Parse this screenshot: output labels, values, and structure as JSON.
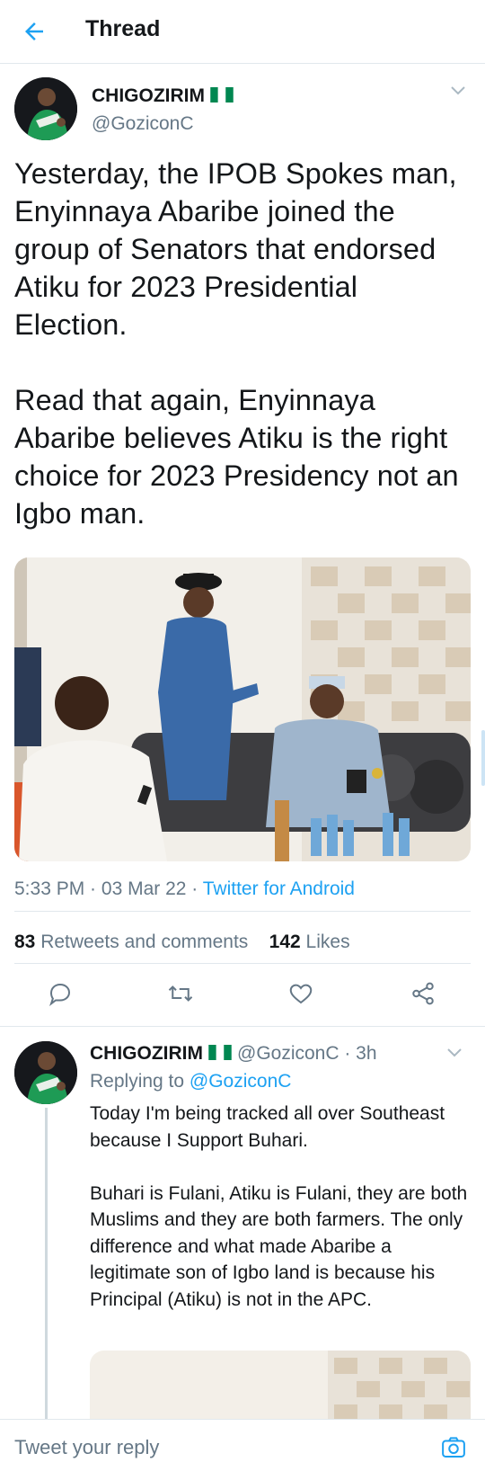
{
  "header": {
    "title": "Thread",
    "back_icon": "arrow-left-icon"
  },
  "main_tweet": {
    "author_name": "CHIGOZIRIM",
    "flag_icon": "nigeria-flag-icon",
    "handle": "@GoziconC",
    "text": "Yesterday, the IPOB Spokes man, Enyinnaya Abaribe joined the group of Senators that endorsed Atiku for 2023 Presidential Election.\n\nRead that again, Enyinnaya Abaribe believes Atiku is the right choice for 2023 Presidency not an Igbo man.",
    "time": "5:33 PM",
    "date_sep": " · ",
    "date": "03 Mar 22",
    "source_sep": " · ",
    "source": "Twitter for Android",
    "retweets_count": "83",
    "retweets_label": "Retweets and comments",
    "likes_count": "142",
    "likes_label": "Likes"
  },
  "actions": [
    "reply-icon",
    "retweet-icon",
    "like-icon",
    "share-icon"
  ],
  "reply": {
    "author_name": "CHIGOZIRIM",
    "handle_time": "@GoziconC · 3h",
    "replying_prefix": "Replying to",
    "replying_to": "@GoziconC",
    "text": "Today I'm being tracked all over Southeast because I Support Buhari.\n\nBuhari is Fulani, Atiku is Fulani, they are both Muslims and they are both farmers. The only difference and what made Abaribe a legitimate son of Igbo land is because his Principal (Atiku) is not in the APC."
  },
  "composer": {
    "placeholder": "Tweet your reply",
    "camera_icon": "camera-icon"
  },
  "colors": {
    "accent": "#1da1f2",
    "secondary_text": "#657786",
    "divider": "#e1e8ed",
    "flag_green": "#008751"
  }
}
